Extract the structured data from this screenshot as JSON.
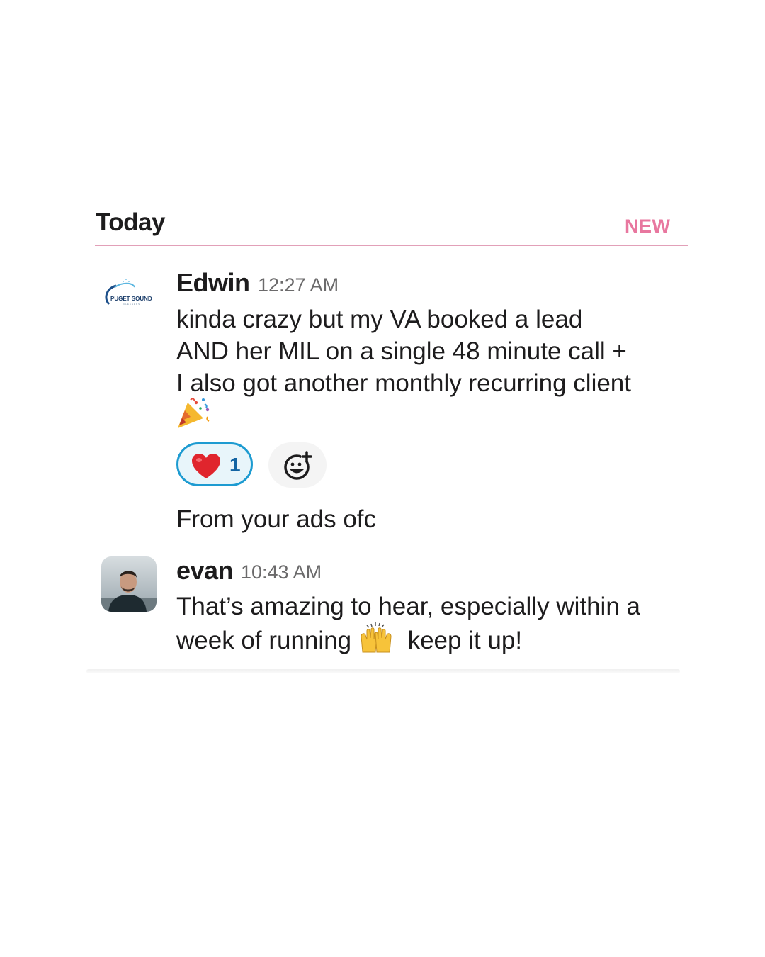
{
  "divider": {
    "label": "Today",
    "new_label": "NEW"
  },
  "messages": [
    {
      "author": "Edwin",
      "time": "12:27 AM",
      "avatar": "puget-sound-logo",
      "logo_text": "PUGET SOUND",
      "logo_subtext": "CLEANERS",
      "text": "kinda crazy but my VA booked a lead\nAND  her MIL on a single 48 minute call +\nI also got another monthly recurring client",
      "emoji": "party-popper-icon",
      "reactions": [
        {
          "icon": "heart-icon",
          "count": "1",
          "active": true
        }
      ],
      "followup": "From your ads ofc"
    },
    {
      "author": "evan",
      "time": "10:43 AM",
      "avatar": "evan-photo",
      "text_line1": "That’s amazing to hear, especially within a",
      "text_line2_before": "week of running",
      "emoji": "raised-hands-icon",
      "text_line2_after": "keep it up!"
    }
  ],
  "colors": {
    "new_accent": "#e8779f",
    "reaction_border": "#1d9bd1",
    "reaction_bg": "#e8f5fa",
    "reaction_count": "#1264a3"
  }
}
